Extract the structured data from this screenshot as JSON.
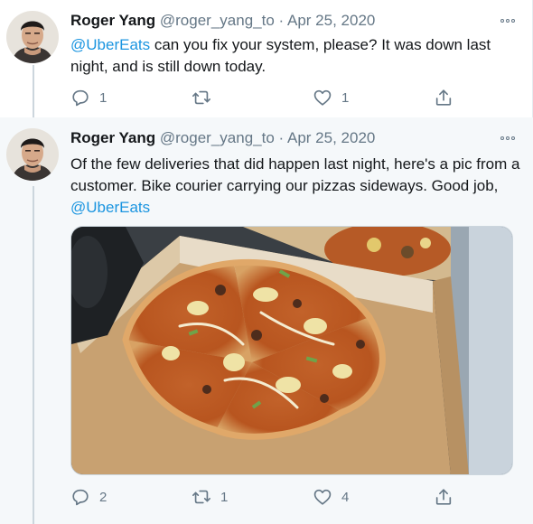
{
  "tweets": [
    {
      "name": "Roger Yang",
      "handle": "@roger_yang_to",
      "separator": "·",
      "date": "Apr 25, 2020",
      "text_mention": "@UberEats",
      "text_rest": " can you fix your system, please? It was down last night, and is still down today.",
      "counts": {
        "reply": "1",
        "retweet": "",
        "like": "1"
      }
    },
    {
      "name": "Roger Yang",
      "handle": "@roger_yang_to",
      "separator": "·",
      "date": "Apr 25, 2020",
      "text_main": "Of the few deliveries that did happen last night, here's a pic from a customer. Bike courier carrying our pizzas sideways. Good job, ",
      "text_mention": "@UberEats",
      "counts": {
        "reply": "2",
        "retweet": "1",
        "like": "4"
      }
    }
  ],
  "icons": {
    "reply": "speech-bubble-icon",
    "retweet": "retweet-arrows-icon",
    "like": "heart-icon",
    "share": "share-upload-icon",
    "more": "more-dots-icon"
  },
  "colors": {
    "link": "#1b95e0",
    "secondary_text": "#657786",
    "reply_background": "#f5f8fa"
  }
}
